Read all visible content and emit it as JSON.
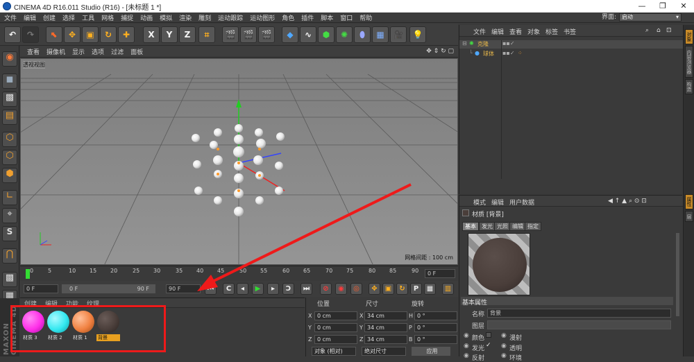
{
  "window": {
    "title": "CINEMA 4D R16.011 Studio (R16) - [未标题 1 *]",
    "buttons": [
      "—",
      "❐",
      "✕"
    ]
  },
  "menubar": {
    "items": [
      "文件",
      "编辑",
      "创建",
      "选择",
      "工具",
      "网格",
      "捕捉",
      "动画",
      "模拟",
      "渲染",
      "雕刻",
      "运动跟踪",
      "运动图形",
      "角色",
      "插件",
      "脚本",
      "窗口",
      "帮助"
    ],
    "layout_label": "界面:",
    "layout_value": "启动"
  },
  "toolbar": {
    "axis_x": "X",
    "axis_y": "Y",
    "axis_z": "Z"
  },
  "viewport": {
    "menu": [
      "查看",
      "摄像机",
      "显示",
      "选项",
      "过滤",
      "面板"
    ],
    "label": "透视视图",
    "grid_spacing": "网格间距 : 100 cm"
  },
  "timeline": {
    "ticks": [
      "0",
      "5",
      "10",
      "15",
      "20",
      "25",
      "30",
      "35",
      "40",
      "45",
      "50",
      "55",
      "60",
      "65",
      "70",
      "75",
      "80",
      "85",
      "90"
    ],
    "current_frame": "0 F"
  },
  "playback": {
    "start_field": "0 F",
    "range_left": "0 F",
    "range_right": "90 F",
    "end_field": "90 F"
  },
  "materials": {
    "menu": [
      "创建",
      "编辑",
      "功能",
      "纹理"
    ],
    "items": [
      {
        "label": "材质 3",
        "color": "#ff2de8"
      },
      {
        "label": "材质 2",
        "color": "#33e8f0"
      },
      {
        "label": "材质 1",
        "color": "#f08040"
      },
      {
        "label": "背景",
        "color": "#4a3e3a"
      }
    ]
  },
  "coordinates": {
    "headers": [
      "位置",
      "尺寸",
      "旋转"
    ],
    "rows": [
      {
        "axis": "X",
        "pos": "0 cm",
        "size_axis": "X",
        "size": "34 cm",
        "rot_axis": "H",
        "rot": "0 °"
      },
      {
        "axis": "Y",
        "pos": "0 cm",
        "size_axis": "Y",
        "size": "34 cm",
        "rot_axis": "P",
        "rot": "0 °"
      },
      {
        "axis": "Z",
        "pos": "0 cm",
        "size_axis": "Z",
        "size": "34 cm",
        "rot_axis": "B",
        "rot": "0 °"
      }
    ],
    "mode_select": "对象 (相对)",
    "size_select": "绝对尺寸",
    "apply": "应用"
  },
  "objects": {
    "menu": [
      "文件",
      "编辑",
      "查看",
      "对象",
      "标签",
      "书签"
    ],
    "tree": [
      {
        "name": "克隆"
      },
      {
        "name": "球体"
      }
    ]
  },
  "attributes": {
    "menu": [
      "模式",
      "编辑",
      "用户数据"
    ],
    "material_title": "材质 [背景]",
    "tabs": [
      "基本",
      "发光",
      "光照",
      "编辑",
      "指定"
    ],
    "section": "基本属性",
    "name_label": "名称",
    "name_value": "背景",
    "layer_label": "图层",
    "checks": [
      {
        "label": "颜色",
        "checked": false
      },
      {
        "label": "漫射",
        "checked": false
      },
      {
        "label": "发光",
        "checked": true
      },
      {
        "label": "透明",
        "checked": false
      },
      {
        "label": "反射",
        "checked": false
      },
      {
        "label": "环境",
        "checked": false
      }
    ],
    "swatch_color": "#4a3e3a"
  },
  "rightbar": {
    "tabs": [
      "对象",
      "内容浏览器",
      "构造",
      "属性",
      "层"
    ]
  },
  "branding": "MAXON CINEMA 4D"
}
